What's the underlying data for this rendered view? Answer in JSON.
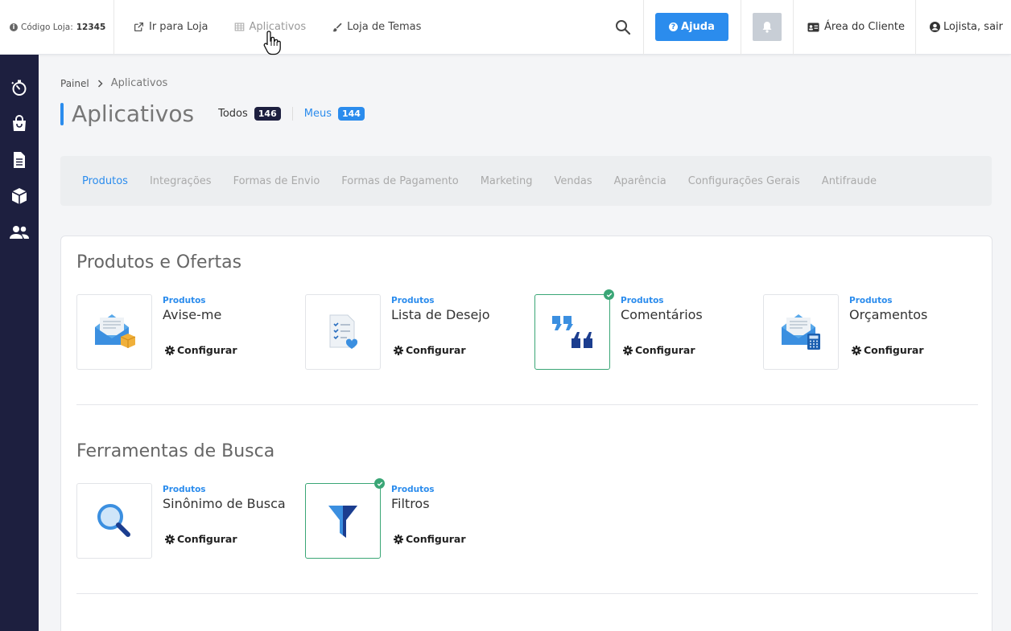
{
  "topbar": {
    "store_code_label": "Código Loja:",
    "store_code_value": "12345",
    "nav": [
      {
        "label": "Ir para Loja",
        "icon": "external-link-icon"
      },
      {
        "label": "Aplicativos",
        "icon": "grid-icon"
      },
      {
        "label": "Loja de Temas",
        "icon": "brush-icon"
      }
    ],
    "help_label": "Ajuda",
    "client_area_label": "Área do Cliente",
    "logout_label": "Lojista, sair"
  },
  "sidebar": {
    "items": [
      {
        "icon": "stopwatch-icon"
      },
      {
        "icon": "shopping-bag-icon"
      },
      {
        "icon": "document-icon"
      },
      {
        "icon": "box-icon"
      },
      {
        "icon": "users-icon"
      }
    ]
  },
  "breadcrumb": {
    "root": "Painel",
    "current": "Aplicativos"
  },
  "page": {
    "title": "Aplicativos",
    "filters": [
      {
        "label": "Todos",
        "count": "146"
      },
      {
        "label": "Meus",
        "count": "144"
      }
    ]
  },
  "category_tabs": [
    "Produtos",
    "Integrações",
    "Formas de Envio",
    "Formas de Pagamento",
    "Marketing",
    "Vendas",
    "Aparência",
    "Configurações Gerais",
    "Antifraude"
  ],
  "sections": [
    {
      "title": "Produtos e Ofertas",
      "apps": [
        {
          "category": "Produtos",
          "name": "Avise-me",
          "action": "Configurar",
          "installed": false
        },
        {
          "category": "Produtos",
          "name": "Lista de Desejo",
          "action": "Configurar",
          "installed": false
        },
        {
          "category": "Produtos",
          "name": "Comentários",
          "action": "Configurar",
          "installed": true
        },
        {
          "category": "Produtos",
          "name": "Orçamentos",
          "action": "Configurar",
          "installed": false
        }
      ]
    },
    {
      "title": "Ferramentas de Busca",
      "apps": [
        {
          "category": "Produtos",
          "name": "Sinônimo de Busca",
          "action": "Configurar",
          "installed": false
        },
        {
          "category": "Produtos",
          "name": "Filtros",
          "action": "Configurar",
          "installed": true
        }
      ]
    }
  ],
  "colors": {
    "accent": "#2b8ced",
    "sidebar": "#1d1f3f",
    "installed": "#3aa676"
  }
}
